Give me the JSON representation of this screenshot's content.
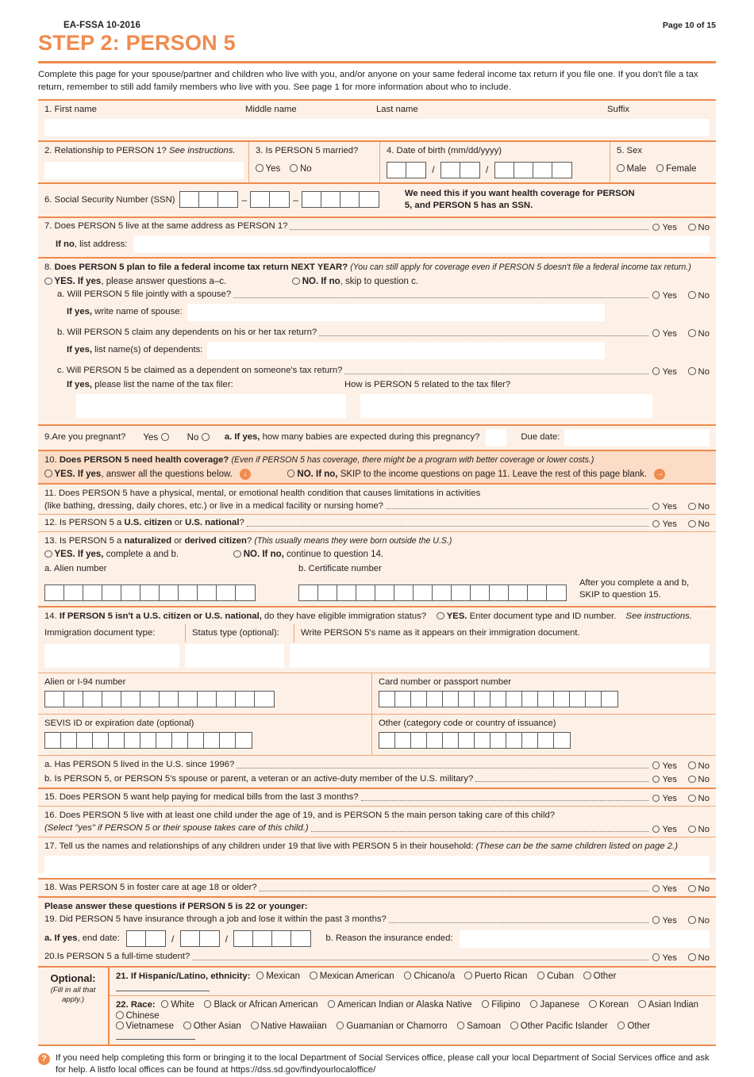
{
  "header": {
    "form_code": "EA-FSSA 10-2016",
    "page_label": "Page 10 of 15",
    "step_title": "STEP 2: PERSON 5",
    "intro": "Complete this page for your spouse/partner and children who live with you, and/or anyone on your same federal income tax return if you file one. If you don't file a tax return, remember to still add family members who live with you. See page 1 for more information about who to include."
  },
  "q1": {
    "first_name": "1. First name",
    "middle_name": "Middle name",
    "last_name": "Last name",
    "suffix": "Suffix"
  },
  "q2": {
    "label": "2. Relationship to PERSON 1?",
    "italic": "See instructions."
  },
  "q3": {
    "label": "3. Is PERSON 5 married?",
    "yes": "Yes",
    "no": "No"
  },
  "q4": {
    "label": "4. Date of birth (mm/dd/yyyy)",
    "mm_cells": 2,
    "dd_cells": 2,
    "yyyy_cells": 4
  },
  "q5": {
    "label": "5. Sex",
    "male": "Male",
    "female": "Female"
  },
  "q6": {
    "label": "6. Social Security Number (SSN)",
    "cells_1": 3,
    "cells_2": 2,
    "cells_3": 4,
    "note": "We need this if you want health coverage for PERSON 5, and PERSON 5 has an SSN."
  },
  "q7": {
    "text": "7. Does PERSON 5 live at the same address as PERSON 1?",
    "yes": "Yes",
    "no": "No",
    "ifno_bold": "If no",
    "ifno_rest": ", list address:"
  },
  "q8": {
    "num": "8.",
    "bold": "Does PERSON 5 plan to file a federal income tax return NEXT YEAR?",
    "italic": "(You can still apply for coverage even if PERSON 5 doesn't file a federal income tax return.)",
    "yes_bold": "YES. If yes",
    "yes_rest": ", please answer questions a–c.",
    "no_bold": "NO. If no",
    "no_rest": ", skip to question c.",
    "a_text": "a. Will PERSON 5 file jointly with a spouse?",
    "a_ifyes_bold": "If yes,",
    "a_ifyes_rest": " write name of spouse:",
    "b_text": "b. Will PERSON 5 claim any dependents on his or her tax return?",
    "b_ifyes_bold": "If yes,",
    "b_ifyes_rest": " list name(s) of dependents:",
    "c_text": "c. Will PERSON 5 be claimed as a dependent on someone's tax return?",
    "c_ifyes_bold": "If yes,",
    "c_ifyes_rest": " please list the name of the tax filer:",
    "c_related": "How is PERSON 5 related to the tax filer?",
    "yes": "Yes",
    "no": "No"
  },
  "q9": {
    "label": "9.Are you pregnant?",
    "yes": "Yes",
    "no": "No",
    "a_bold": "a. If yes,",
    "a_rest": " how many babies are expected during this pregnancy?",
    "due": "Due date:"
  },
  "q10": {
    "num": "10.",
    "bold": "Does PERSON 5 need health coverage?",
    "italic": "(Even if PERSON 5 has coverage, there might be a program with better coverage or lower costs.)",
    "yes_bold": "YES. If yes",
    "yes_rest": ", answer all the questions below.",
    "no_bold": "NO. If no,",
    "no_rest": " SKIP to the income questions on page 11. Leave the rest of this page blank.",
    "arrow_down": "↓",
    "arrow_right": "→"
  },
  "q11": {
    "line1": "11. Does PERSON 5 have a physical, mental, or emotional health condition that causes limitations in activities",
    "line2": "(like bathing, dressing, daily chores, etc.) or live in a medical facility or nursing home?",
    "yes": "Yes",
    "no": "No"
  },
  "q12": {
    "pre": "12. Is  PERSON 5 a ",
    "b1": "U.S. citizen",
    "mid": " or ",
    "b2": "U.S. national",
    "post": "?",
    "yes": "Yes",
    "no": "No"
  },
  "q13": {
    "pre": "13. Is PERSON 5 a ",
    "b1": "naturalized",
    "mid": " or ",
    "b2": "derived citizen",
    "post": "?",
    "italic": "(This usually means they were born outside the U.S.)",
    "yes_bold": "YES. If yes,",
    "yes_rest": " complete a and b.",
    "no_bold": "NO. If no,",
    "no_rest": " continue to question 14.",
    "a_label": "a. Alien number",
    "a_cells": 11,
    "b_label": "b. Certificate number",
    "b_cells": 14,
    "after_line1": "After you complete a and b,",
    "after_line2": "SKIP to question 15."
  },
  "q14": {
    "num": "14. ",
    "bold": "If PERSON 5 isn't a U.S. citizen or U.S. national,",
    "rest": " do they have eligible immigration status?",
    "yes_bold": "YES.",
    "yes_rest": " Enter document type and ID number.",
    "italic": "See instructions.",
    "doc_type": "Immigration document type:",
    "status_type": "Status type (optional):",
    "write_name": "Write PERSON 5's name as it appears on their immigration document.",
    "alien_i94": "Alien or I-94 number",
    "alien_i94_cells": 12,
    "card_passport": "Card number or passport number",
    "card_passport_cells": 15,
    "sevis": "SEVIS ID or expiration date (optional)",
    "sevis_cells": 13,
    "other": "Other (category code or country of issuance)",
    "other_cells": 12,
    "a_text": "a. Has PERSON 5 lived in the U.S. since 1996?",
    "b_text": "b. Is PERSON 5, or PERSON 5's spouse or parent, a veteran or an active-duty member of the U.S. military?",
    "yes": "Yes",
    "no": "No"
  },
  "q15": {
    "text": "15. Does PERSON 5 want help paying for medical bills from the last 3 months?",
    "yes": "Yes",
    "no": "No"
  },
  "q16": {
    "line1": "16. Does PERSON 5 live with at least one child under the age of 19, and is PERSON 5 the main person taking care of this child?",
    "line2": "(Select \"yes\" if PERSON 5 or their spouse takes care of this child.)",
    "yes": "Yes",
    "no": "No"
  },
  "q17": {
    "text": "17. Tell us the names and relationships of any children under 19 that live with PERSON 5 in their household:",
    "italic": "(These can be the same children listed on page 2.)"
  },
  "q18": {
    "text": "18. Was PERSON 5 in foster care at age 18 or older?",
    "yes": "Yes",
    "no": "No"
  },
  "q19": {
    "heading": "Please answer these questions if PERSON 5 is 22 or younger:",
    "text": "19.  Did PERSON 5 have insurance through a job and lose it within the past 3 months?",
    "yes": "Yes",
    "no": "No",
    "a_bold": "a. If yes",
    "a_rest": ", end date:",
    "mm_cells": 2,
    "dd_cells": 2,
    "yyyy_cells": 4,
    "b_text": "b. Reason the insurance ended:"
  },
  "q20": {
    "text": "20.Is PERSON 5 a full-time student?",
    "yes": "Yes",
    "no": "No"
  },
  "optional": {
    "title": "Optional:",
    "subtitle": "(Fill in all that apply.)",
    "q21_label": "21. If Hispanic/Latino, ethnicity:",
    "q21_options": [
      "Mexican",
      "Mexican American",
      "Chicano/a",
      "Puerto Rican",
      "Cuban",
      "Other"
    ],
    "q22_label": "22. Race:",
    "q22_options_row1": [
      "White",
      "Black or African American",
      "American Indian or Alaska Native",
      "Filipino",
      "Japanese",
      "Korean",
      "Asian Indian",
      "Chinese"
    ],
    "q22_options_row2": [
      "Vietnamese",
      "Other Asian",
      "Native Hawaiian",
      "Guamanian or Chamorro",
      "Samoan",
      "Other Pacific Islander",
      "Other"
    ]
  },
  "footer": {
    "icon": "?",
    "text": "If you need help completing this form or bringing it to the local Department of Social Services office, please call your local Department of Social Services office and ask for help. A listfo local offices can be found at https://dss.sd.gov/findyourlocaloffice/"
  },
  "colors": {
    "accent": "#ef8b4e",
    "panel": "#fdf0e6",
    "highlight": "#fbdcc6",
    "text": "#231f20"
  }
}
